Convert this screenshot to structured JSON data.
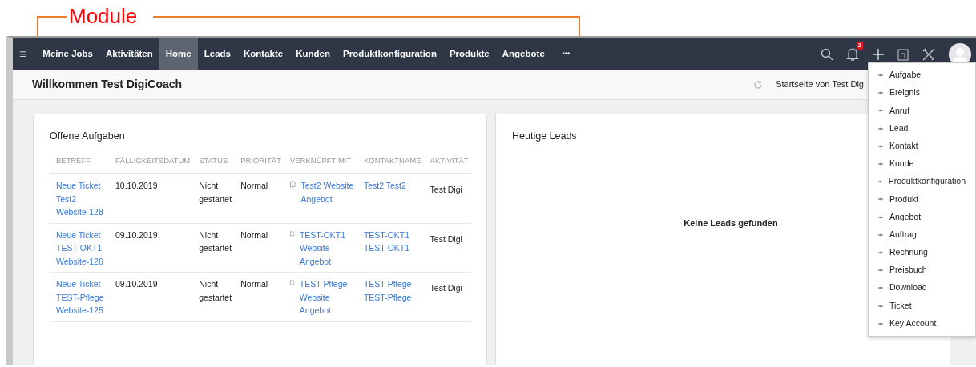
{
  "annotation": {
    "label": "Module"
  },
  "navbar": {
    "menu_icon": "≡",
    "items": [
      {
        "label": "Meine Jobs",
        "selected": false
      },
      {
        "label": "Aktivitäten",
        "selected": false
      },
      {
        "label": "Home",
        "selected": true
      },
      {
        "label": "Leads",
        "selected": false
      },
      {
        "label": "Kontakte",
        "selected": false
      },
      {
        "label": "Kunden",
        "selected": false
      },
      {
        "label": "Produktkonfiguration",
        "selected": false
      },
      {
        "label": "Produkte",
        "selected": false
      },
      {
        "label": "Angebote",
        "selected": false
      }
    ],
    "more": "•••",
    "notification_count": "2"
  },
  "header": {
    "title": "Willkommen Test DigiCoach",
    "home_label": "Startseite von Test Dig"
  },
  "tasks": {
    "title": "Offene Aufgaben",
    "columns": [
      "BETREFF",
      "FÄLLIGKEITSDATUM",
      "STATUS",
      "PRIORITÄT",
      "VERKNÜPFT MIT",
      "KONTAKTNAME",
      "AKTIVITÄT"
    ],
    "rows": [
      {
        "subject": "Neue Ticket Test2 Website-128",
        "due": "10.10.2019",
        "status": "Nicht gestartet",
        "priority": "Normal",
        "related": "Test2 Website Angebot",
        "contact": "Test2 Test2",
        "activity": "Test Digi"
      },
      {
        "subject": "Neue Ticket TEST-OKT1 Website-126",
        "due": "09.10.2019",
        "status": "Nicht gestartet",
        "priority": "Normal",
        "related": "TEST-OKT1 Website Angebot",
        "contact": "TEST-OKT1 TEST-OKT1",
        "activity": "Test Digi"
      },
      {
        "subject": "Neue Ticket TEST-Pflege Website-125",
        "due": "09.10.2019",
        "status": "Nicht gestartet",
        "priority": "Normal",
        "related": "TEST-Pflege Website Angebot",
        "contact": "TEST-Pflege TEST-Pflege",
        "activity": "Test Digi"
      }
    ]
  },
  "leads": {
    "title": "Heutige Leads",
    "empty_message": "Keine Leads gefunden"
  },
  "create_menu": {
    "items": [
      "Aufgabe",
      "Ereignis",
      "Anruf",
      "Lead",
      "Kontakt",
      "Kunde",
      "Produktkonfiguration",
      "Produkt",
      "Angebot",
      "Auftrag",
      "Rechnung",
      "Preisbuch",
      "Download",
      "Ticket",
      "Key Account"
    ]
  }
}
